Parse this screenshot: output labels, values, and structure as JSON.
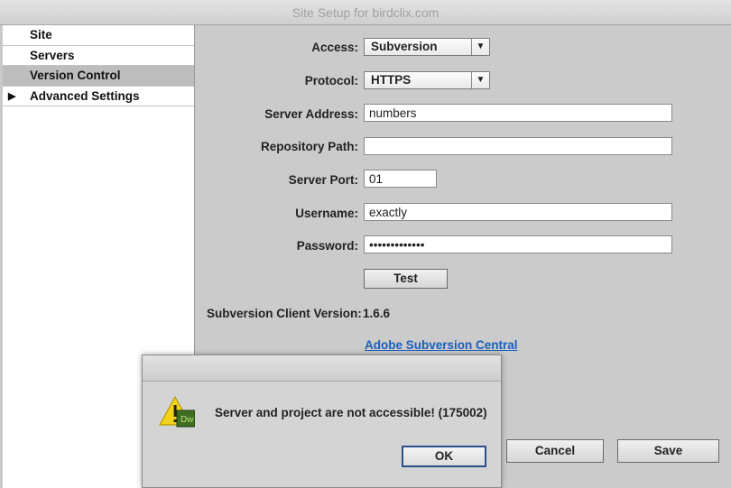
{
  "window": {
    "title": "Site Setup for birdclix.com"
  },
  "sidebar": {
    "items": [
      {
        "label": "Site",
        "selected": false
      },
      {
        "label": "Servers",
        "selected": false
      },
      {
        "label": "Version Control",
        "selected": true
      },
      {
        "label": "Advanced Settings",
        "selected": false,
        "expandable": true
      }
    ]
  },
  "form": {
    "access": {
      "label": "Access:",
      "value": "Subversion"
    },
    "protocol": {
      "label": "Protocol:",
      "value": "HTTPS"
    },
    "server_address": {
      "label": "Server Address:",
      "value": "numbers"
    },
    "repository_path": {
      "label": "Repository Path:",
      "value": ""
    },
    "server_port": {
      "label": "Server Port:",
      "value": "01"
    },
    "username": {
      "label": "Username:",
      "value": "exactly"
    },
    "password": {
      "label": "Password:",
      "value": "•••••••••••••"
    },
    "test_button": "Test",
    "client_version_label": "Subversion Client Version:",
    "client_version_value": "1.6.6",
    "central_link": "Adobe Subversion Central"
  },
  "footer": {
    "cancel_label": "Cancel",
    "save_label": "Save"
  },
  "alert": {
    "message": "Server and project are not accessible! (175002)",
    "ok_label": "OK",
    "app_badge": "Dw",
    "colors": {
      "warning_yellow": "#f2d21a",
      "badge_green": "#3f6d22"
    }
  }
}
